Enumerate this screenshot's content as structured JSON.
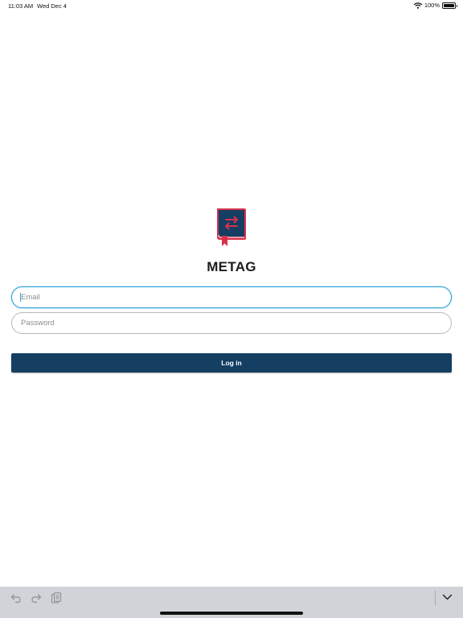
{
  "status_bar": {
    "time": "11:03 AM",
    "date": "Wed Dec 4",
    "battery": "100%",
    "battery_level": 1.0,
    "icons": [
      "wifi-icon",
      "battery-icon"
    ]
  },
  "app": {
    "name": "METAG",
    "logo_icon": "book-swap-logo",
    "colors": {
      "primary": "#153e63",
      "accent": "#d8314c",
      "focus": "#2aa3d8"
    }
  },
  "form": {
    "email_placeholder": "Email",
    "email_value": "",
    "password_placeholder": "Password",
    "password_value": "",
    "login_label": "Log in"
  },
  "keyboard_bar": {
    "icons": [
      "undo-icon",
      "redo-icon",
      "paste-icon",
      "dismiss-keyboard-icon"
    ]
  }
}
